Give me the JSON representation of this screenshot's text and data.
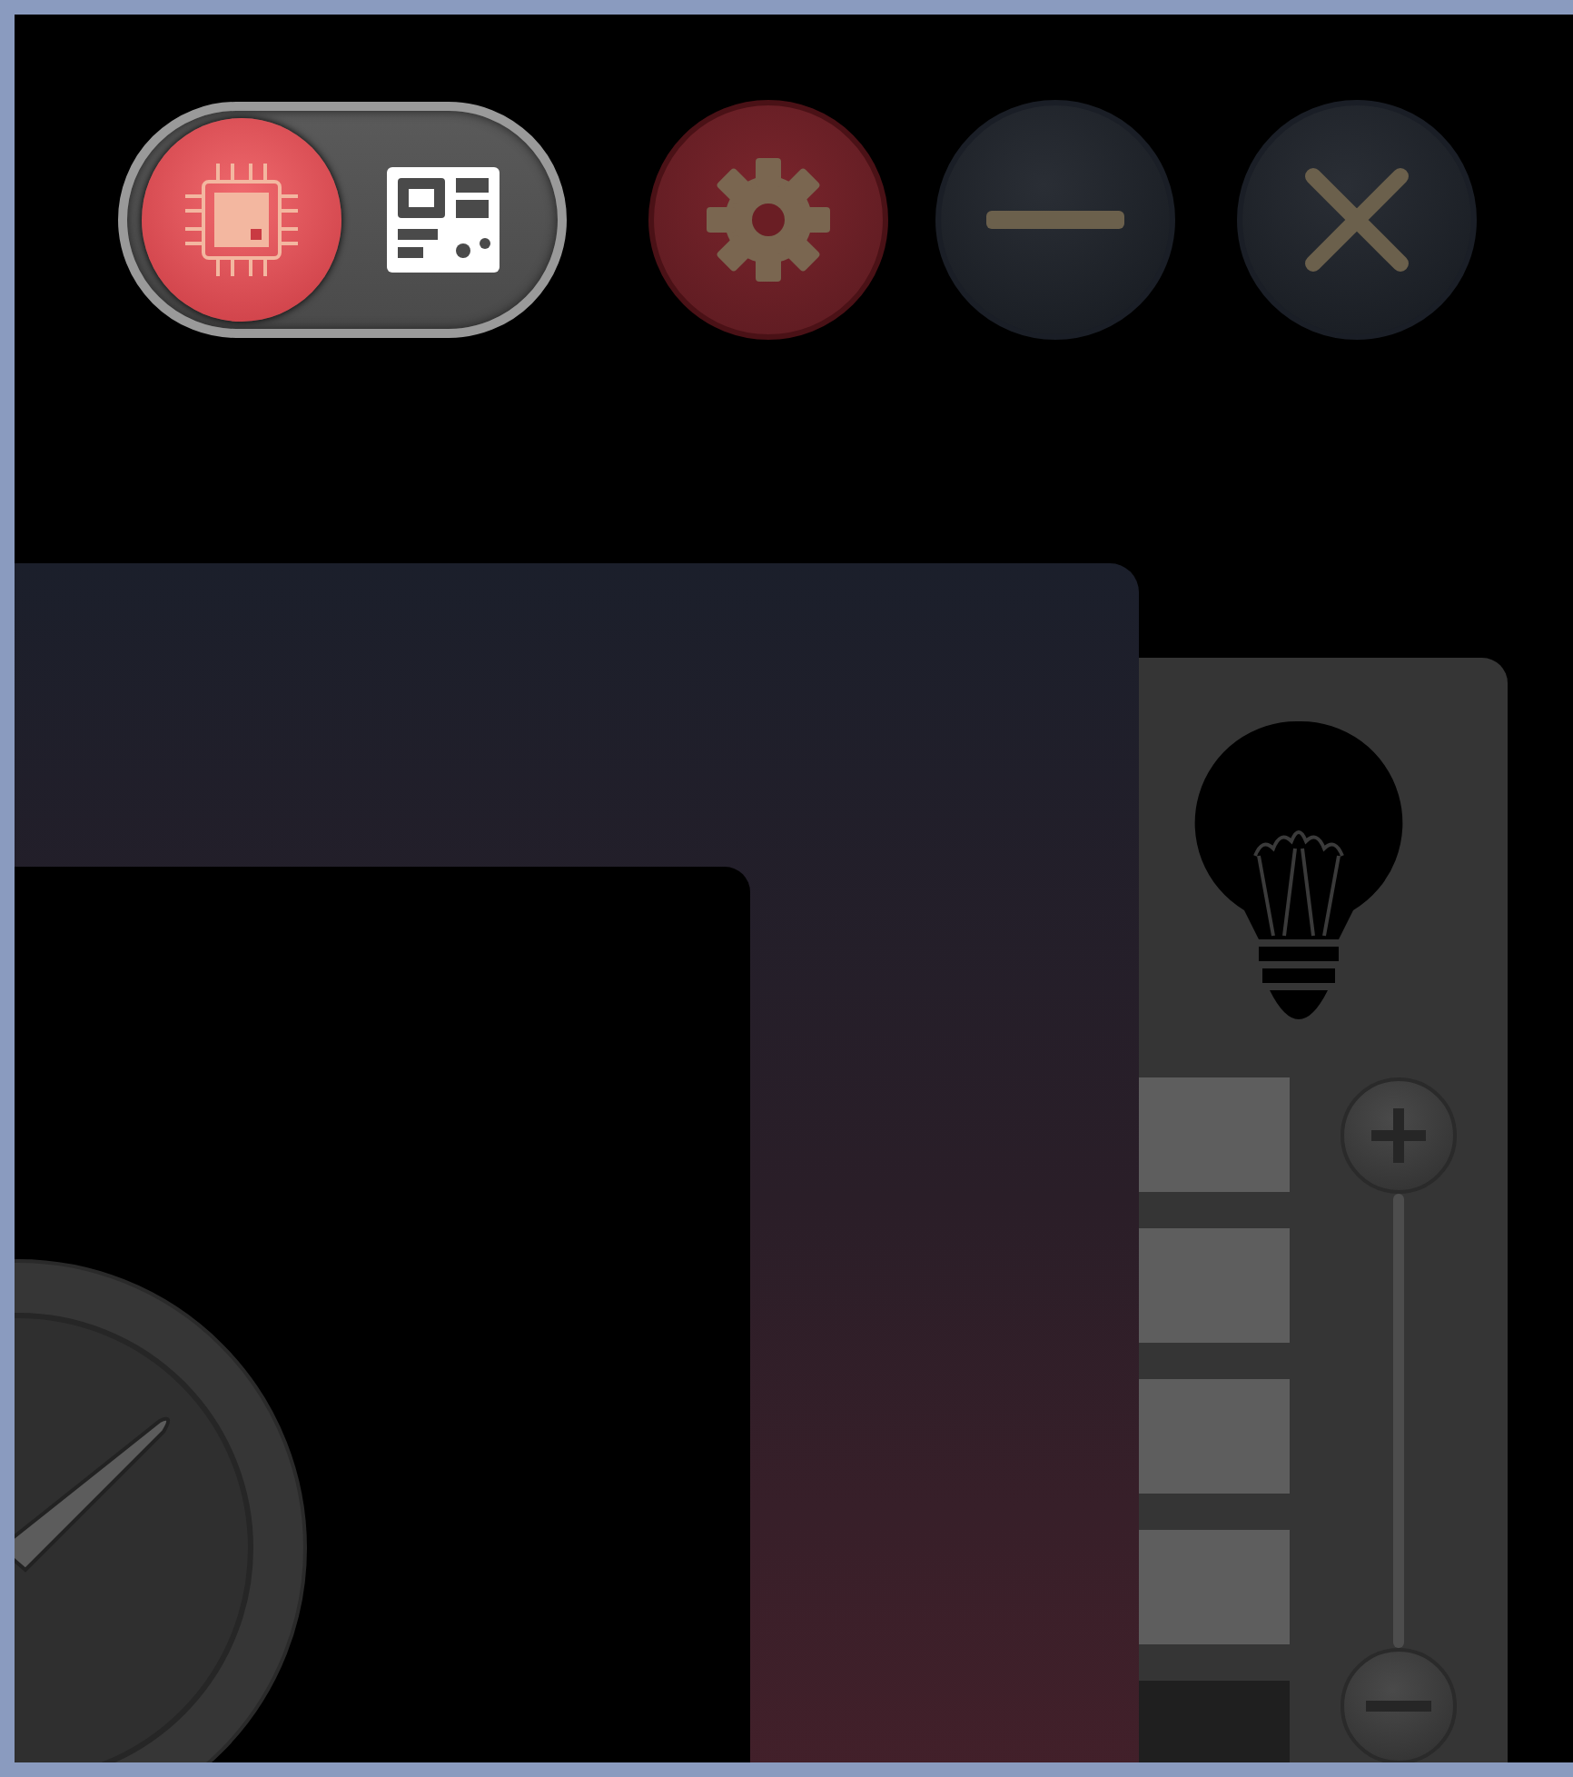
{
  "mode_toggle": [
    {
      "kind": "chip",
      "selected": true
    },
    {
      "kind": "board",
      "selected": false
    }
  ],
  "brightness": {
    "segments": [
      {
        "on": true
      },
      {
        "on": true
      },
      {
        "on": true
      },
      {
        "on": true
      },
      {
        "on": false
      }
    ]
  }
}
